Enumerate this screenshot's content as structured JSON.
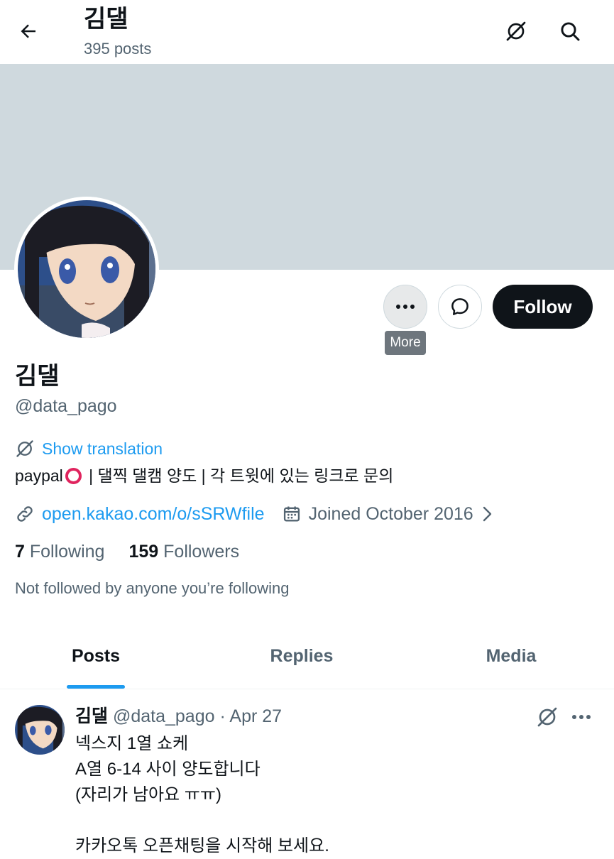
{
  "header": {
    "title": "김댈",
    "post_count": "395 posts"
  },
  "profile": {
    "name": "김댈",
    "handle": "@data_pago",
    "show_translation": "Show translation",
    "bio_prefix": "paypal",
    "bio_suffix": " | 댈찍 댈캠 양도 | 각 트윗에 있는 링크로 문의",
    "link": "open.kakao.com/o/sSRWfile",
    "joined": "Joined October 2016",
    "following_count": "7",
    "following_label": "Following",
    "followers_count": "159",
    "followers_label": "Followers",
    "not_followed": "Not followed by anyone you’re following"
  },
  "actions": {
    "follow_label": "Follow",
    "more_tooltip": "More"
  },
  "tabs": [
    {
      "label": "Posts"
    },
    {
      "label": "Replies"
    },
    {
      "label": "Media"
    }
  ],
  "post": {
    "name": "김댈",
    "handle": "@data_pago",
    "separator": "·",
    "date": "Apr 27",
    "lines": [
      "넥스지 1열 쇼케",
      "A열 6-14 사이 양도합니다",
      "(자리가 남아요 ㅠㅠ)",
      "",
      "카카오톡 오픈채팅을 시작해 보세요."
    ]
  },
  "colors": {
    "accent": "#1d9bf0",
    "text": "#0f1419",
    "secondary": "#536471",
    "banner": "#cfd9de",
    "follow_bg": "#0f1419"
  }
}
